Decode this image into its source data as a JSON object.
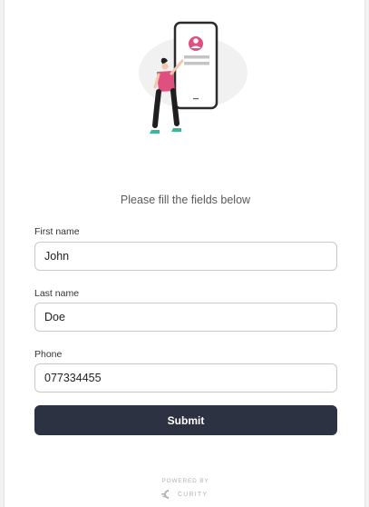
{
  "form": {
    "instructions": "Please fill the fields below",
    "fields": [
      {
        "label": "First name",
        "value": "John"
      },
      {
        "label": "Last name",
        "value": "Doe"
      },
      {
        "label": "Phone",
        "value": "077334455"
      }
    ],
    "submit_label": "Submit"
  },
  "footer": {
    "powered_by": "POWERED BY",
    "brand": "CURITY"
  },
  "colors": {
    "button_bg": "#2c3241",
    "accent_pink": "#e0507f",
    "border": "#c9c9c9"
  },
  "icons": {
    "illustration": "person-with-phone-illustration",
    "brand_logo": "curity-logo-icon"
  }
}
